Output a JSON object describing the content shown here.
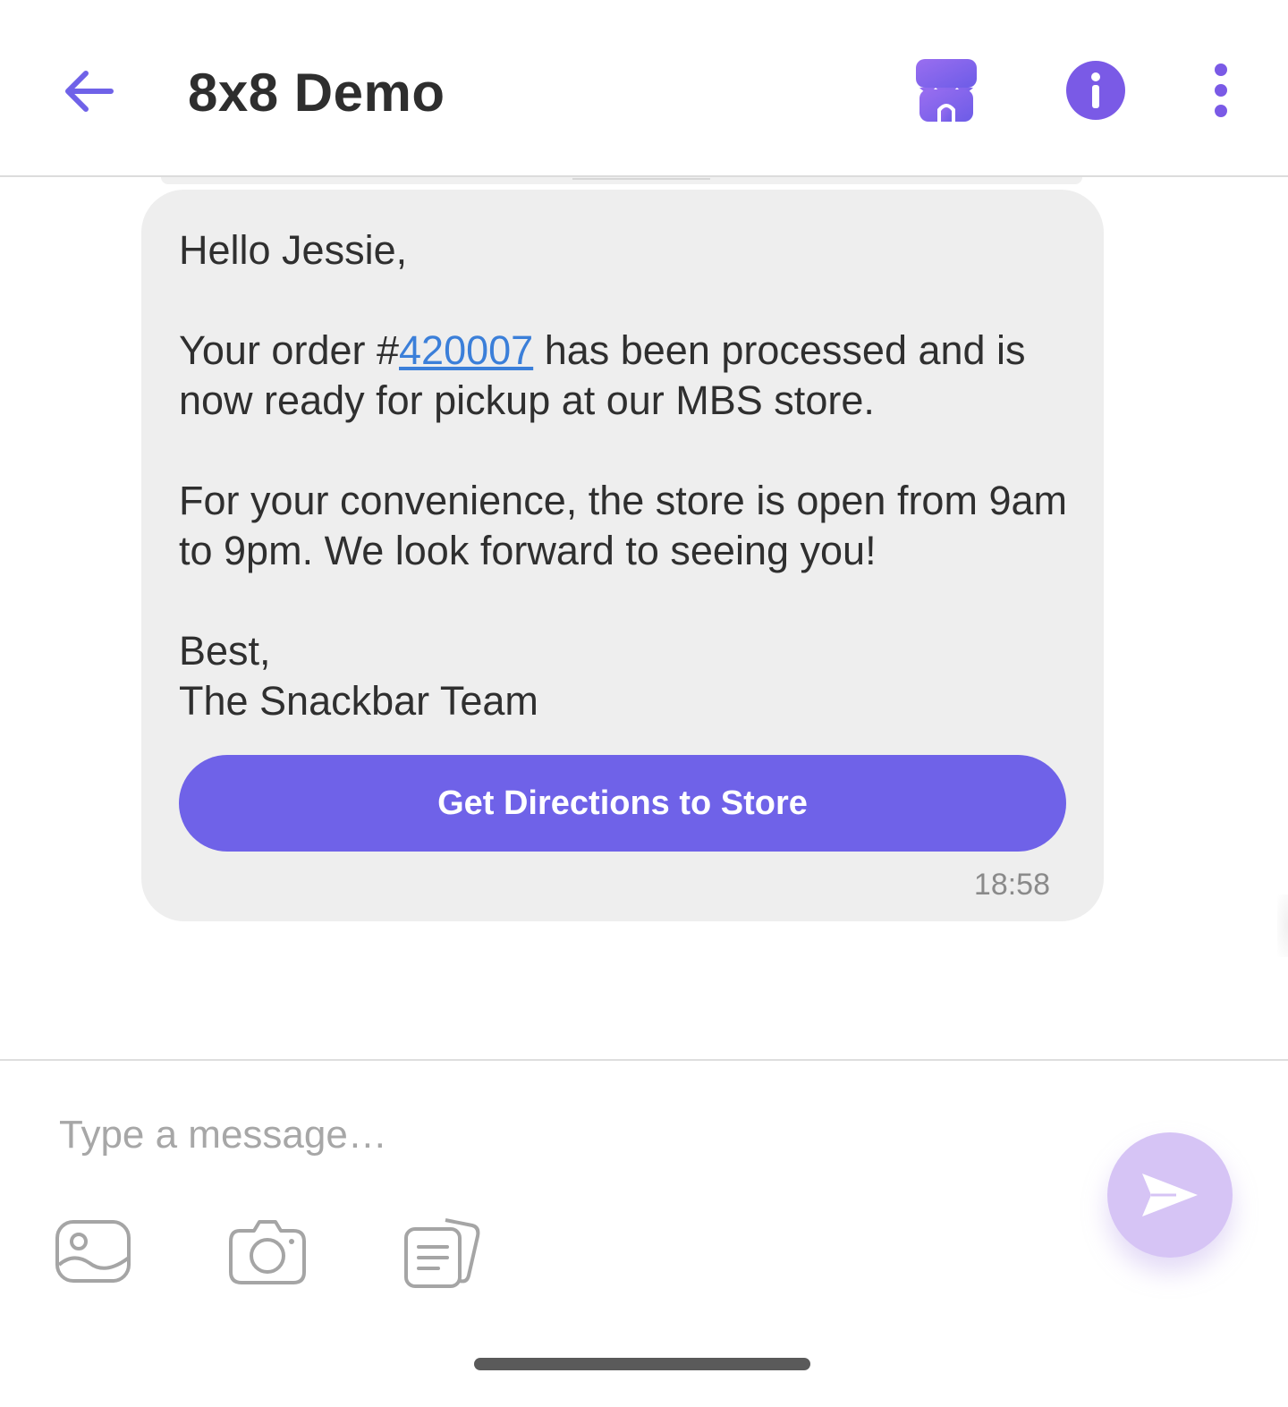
{
  "header": {
    "title": "8x8 Demo",
    "back_icon": "arrow-left-icon",
    "store_icon": "storefront-icon",
    "info_icon": "info-icon",
    "more_icon": "more-vertical-icon"
  },
  "message": {
    "greeting": "Hello Jessie,",
    "order_prefix": "Your order #",
    "order_number": "420007",
    "order_suffix": " has been processed and is now ready for pickup at our MBS store.",
    "hours": "For your convenience, the store is open from 9am to 9pm. We look forward to seeing you!",
    "closing": "Best,",
    "signature": "The Snackbar Team",
    "button_label": "Get Directions to Store",
    "timestamp": "18:58"
  },
  "composer": {
    "placeholder": "Type a message…",
    "value": "",
    "tools": [
      "gallery-icon",
      "camera-icon",
      "document-icon"
    ],
    "send_icon": "send-icon"
  },
  "colors": {
    "accent": "#6f62e8",
    "bubble": "#eeeeee",
    "link": "#3b7fd9",
    "send_button": "#d6c4f5",
    "store_gradient_start": "#8e66ea",
    "store_gradient_end": "#6c5ce7"
  }
}
